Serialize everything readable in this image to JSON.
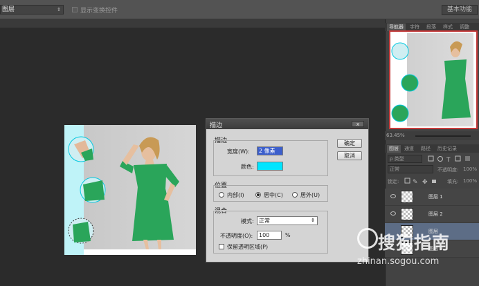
{
  "options_bar": {
    "layer_select_value": "图层",
    "show_transform_label": "显示变换控件",
    "workspace_button": "基本功能"
  },
  "panels": {
    "top_tabs": [
      "导航器",
      "字符",
      "段落",
      "样式",
      "调整"
    ],
    "zoom_value": "63.45%",
    "layers_tabs": [
      "图层",
      "通道",
      "路径",
      "历史记录"
    ],
    "kind_filter": "ρ 类型",
    "blend_mode": "正常",
    "opacity_label": "不透明度:",
    "opacity_value": "100%",
    "lock_label": "锁定:",
    "fill_label": "填充:",
    "fill_value": "100%",
    "layers": [
      {
        "name": "图层 1"
      },
      {
        "name": "图层 2"
      },
      {
        "name": "图层"
      },
      {
        "name": "图层 3"
      }
    ]
  },
  "dialog": {
    "title": "描边",
    "close_label": "x",
    "stroke_group": "描边",
    "width_label": "宽度(W):",
    "width_value": "2 像素",
    "color_label": "颜色:",
    "color_swatch": "#00e5ff",
    "position_group": "位置",
    "pos_inside": "内部(I)",
    "pos_center": "居中(C)",
    "pos_outside": "居外(U)",
    "blend_group": "混合",
    "mode_label": "模式:",
    "mode_value": "正常",
    "opacity_label": "不透明度(O):",
    "opacity_value": "100",
    "opacity_unit": "%",
    "preserve_label": "保留透明区域(P)",
    "ok_label": "确定",
    "cancel_label": "取消"
  },
  "watermark": {
    "text": "搜狗指南",
    "url": "zhinan.sogou.com"
  },
  "colors": {
    "dress": "#2aa55a",
    "selection_cyan": "#00e5ff",
    "nav_frame": "#c43a3a"
  }
}
